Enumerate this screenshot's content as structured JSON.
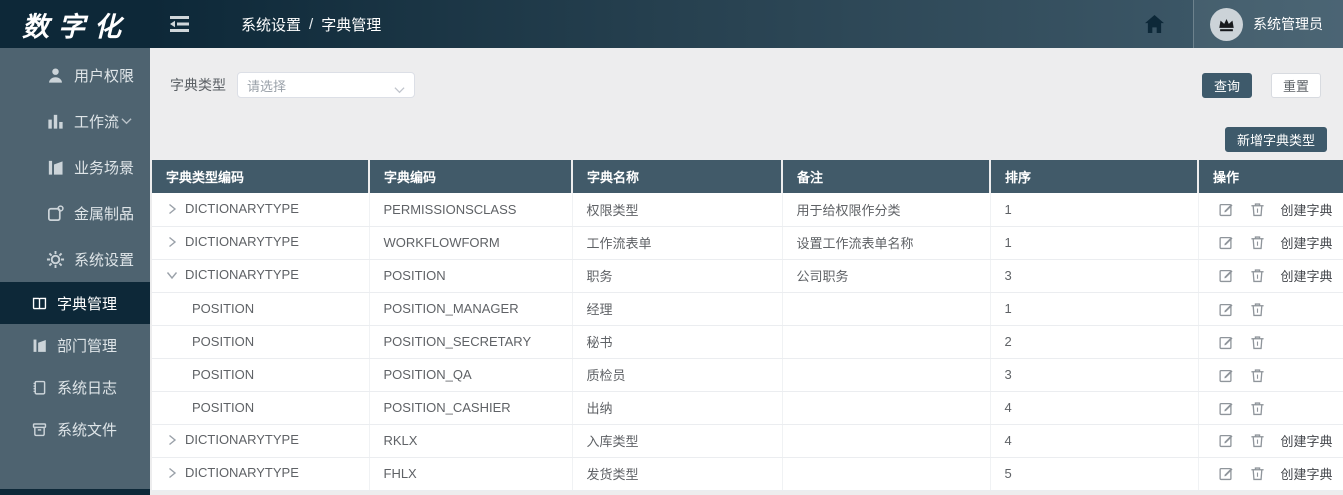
{
  "app": {
    "logo_text": "数字化",
    "colors": {
      "accent": "#3e5a6b",
      "sidebar": "#4e6370",
      "dark": "#0d2838",
      "header_bg": "#415a69",
      "content_bg": "#ededee"
    }
  },
  "header": {
    "breadcrumb": {
      "parent": "系统设置",
      "separator": "/",
      "current": "字典管理"
    },
    "icons": [
      "collapse-menu-icon",
      "home-icon",
      "crown-avatar-icon"
    ],
    "username": "系统管理员"
  },
  "sidebar": {
    "items": [
      {
        "label": "用户权限",
        "icon": "user-icon",
        "state": "collapsed"
      },
      {
        "label": "工作流",
        "icon": "workflow-icon",
        "state": "collapsed"
      },
      {
        "label": "业务场景",
        "icon": "business-scene-icon",
        "state": "collapsed"
      },
      {
        "label": "金属制品",
        "icon": "metal-product-icon",
        "state": "collapsed"
      },
      {
        "label": "系统设置",
        "icon": "settings-gear-icon",
        "state": "expanded"
      }
    ],
    "subitems": [
      {
        "label": "字典管理",
        "icon": "dictionary-book-icon",
        "active": true
      },
      {
        "label": "部门管理",
        "icon": "department-icon",
        "active": false
      },
      {
        "label": "系统日志",
        "icon": "system-log-icon",
        "active": false
      },
      {
        "label": "系统文件",
        "icon": "system-file-icon",
        "active": false
      }
    ]
  },
  "filter": {
    "label": "字典类型",
    "select_placeholder": "请选择",
    "search_label": "查询",
    "reset_label": "重置"
  },
  "toolbar": {
    "add_label": "新增字典类型"
  },
  "table": {
    "columns": [
      "字典类型编码",
      "字典编码",
      "字典名称",
      "备注",
      "排序",
      "操作"
    ],
    "create_label": "创建字典",
    "rows": [
      {
        "type": "DICTIONARYTYPE",
        "code": "PERMISSIONSCLASS",
        "name": "权限类型",
        "remark": "用于给权限作分类",
        "sort": 1,
        "level": "parent",
        "expand": "closed",
        "actions": [
          "edit",
          "delete",
          "create"
        ]
      },
      {
        "type": "DICTIONARYTYPE",
        "code": "WORKFLOWFORM",
        "name": "工作流表单",
        "remark": "设置工作流表单名称",
        "sort": 1,
        "level": "parent",
        "expand": "closed",
        "actions": [
          "edit",
          "delete",
          "create"
        ]
      },
      {
        "type": "DICTIONARYTYPE",
        "code": "POSITION",
        "name": "职务",
        "remark": "公司职务",
        "sort": 3,
        "level": "parent",
        "expand": "open",
        "actions": [
          "edit",
          "delete",
          "create"
        ]
      },
      {
        "type": "POSITION",
        "code": "POSITION_MANAGER",
        "name": "经理",
        "remark": "",
        "sort": 1,
        "level": "child",
        "expand": "none",
        "actions": [
          "edit",
          "delete"
        ]
      },
      {
        "type": "POSITION",
        "code": "POSITION_SECRETARY",
        "name": "秘书",
        "remark": "",
        "sort": 2,
        "level": "child",
        "expand": "none",
        "actions": [
          "edit",
          "delete"
        ]
      },
      {
        "type": "POSITION",
        "code": "POSITION_QA",
        "name": "质检员",
        "remark": "",
        "sort": 3,
        "level": "child",
        "expand": "none",
        "actions": [
          "edit",
          "delete"
        ]
      },
      {
        "type": "POSITION",
        "code": "POSITION_CASHIER",
        "name": "出纳",
        "remark": "",
        "sort": 4,
        "level": "child",
        "expand": "none",
        "actions": [
          "edit",
          "delete"
        ]
      },
      {
        "type": "DICTIONARYTYPE",
        "code": "RKLX",
        "name": "入库类型",
        "remark": "",
        "sort": 4,
        "level": "parent",
        "expand": "closed",
        "actions": [
          "edit",
          "delete",
          "create"
        ]
      },
      {
        "type": "DICTIONARYTYPE",
        "code": "FHLX",
        "name": "发货类型",
        "remark": "",
        "sort": 5,
        "level": "parent",
        "expand": "closed",
        "actions": [
          "edit",
          "delete",
          "create"
        ]
      }
    ]
  }
}
